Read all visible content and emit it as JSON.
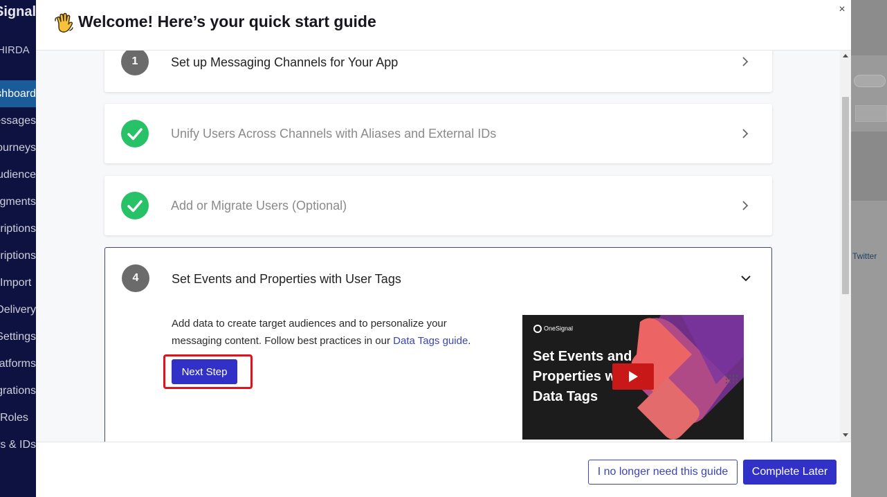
{
  "background": {
    "logo_text": "OneSignal",
    "org_name": "HIRDA",
    "nav_items": [
      "Dashboard",
      "Messages",
      "Journeys",
      "Audience",
      "Segments",
      "Subscriptions",
      "Test Subscriptions",
      "Import",
      "Delivery",
      "Settings",
      "Platforms",
      "Integrations",
      "Roles",
      "Keys & IDs"
    ],
    "twitter_label": "Twitter"
  },
  "modal": {
    "title": "Welcome! Here’s your quick start guide",
    "close_label": "×"
  },
  "steps": [
    {
      "number": "1",
      "title": "Set up Messaging Channels for Your App",
      "completed": false
    },
    {
      "number": "2",
      "title": "Unify Users Across Channels with Aliases and External IDs",
      "completed": true
    },
    {
      "number": "3",
      "title": "Add or Migrate Users (Optional)",
      "completed": true
    },
    {
      "number": "4",
      "title": "Set Events and Properties with User Tags",
      "completed": false,
      "expanded": true
    }
  ],
  "active_step": {
    "description_prefix": "Add data to create target audiences and to personalize your messaging content. Follow best practices in our ",
    "link_text": "Data Tags guide",
    "description_suffix": ".",
    "next_button": "Next Step",
    "video": {
      "brand": "OneSignal",
      "title": "Set Events and Properties with Data Tags"
    }
  },
  "footer": {
    "dismiss_button": "I no longer need this guide",
    "later_button": "Complete Later"
  },
  "colors": {
    "primary": "#3131c8",
    "success": "#27c267",
    "highlight": "#e0121b",
    "step_number_bg": "#6b6b6b"
  }
}
